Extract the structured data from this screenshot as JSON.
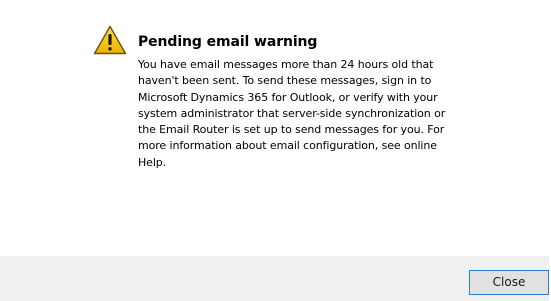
{
  "dialog": {
    "title": "Pending email warning",
    "message": "You have email messages more than 24 hours old that haven't been sent. To send these messages, sign in to Microsoft Dynamics 365 for Outlook, or verify with your system administrator that server-side synchronization or the Email Router is set up to send messages for you. For more information about email configuration, see online Help.",
    "icon": "warning-triangle-icon",
    "close_label": "Close"
  },
  "colors": {
    "warning_fill": "#f5c400",
    "warning_outline": "#7a6000",
    "button_border": "#2f7dd1",
    "footer_bg": "#f0f0f0"
  }
}
